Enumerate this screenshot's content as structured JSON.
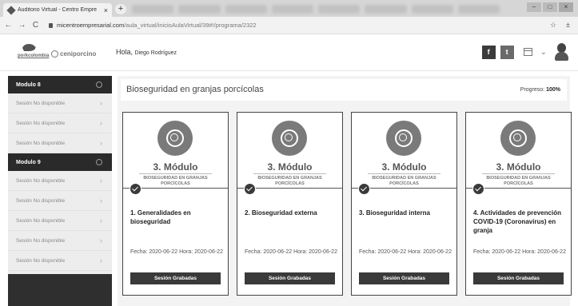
{
  "browser": {
    "tab_title": "Auditorio Virtual - Centro Empre",
    "tab_close": "×",
    "new_tab": "+",
    "url_host": "micentroempresarial.com",
    "url_path": "/aula_virtual/inicioAulaVirtual/39#!/programa/2322",
    "window_controls": [
      "–",
      "□",
      "×"
    ]
  },
  "header": {
    "logo_left": "porkcolombia",
    "logo_right": "ceniporcino",
    "greeting": "Hola,",
    "user_name": "Diego Rodríguez",
    "facebook": "f",
    "twitter": "t"
  },
  "sidebar": {
    "items": [
      {
        "type": "module",
        "label": "Modulo 8"
      },
      {
        "type": "session",
        "label": "Sesión No disponible"
      },
      {
        "type": "session",
        "label": "Sesión No disponible"
      },
      {
        "type": "session",
        "label": "Sesión No disponible"
      },
      {
        "type": "module",
        "label": "Modulo 9"
      },
      {
        "type": "session",
        "label": "Sesión No disponible"
      },
      {
        "type": "session",
        "label": "Sesión No disponible"
      },
      {
        "type": "session",
        "label": "Sesión No disponible"
      },
      {
        "type": "session",
        "label": "Sesión No disponible"
      },
      {
        "type": "session",
        "label": "Sesión No disponible"
      }
    ]
  },
  "main": {
    "title": "Bioseguridad en granjas porcícolas",
    "progress_label": "Progreso:",
    "progress_value": "100%",
    "cards": [
      {
        "module": "3. Módulo",
        "subtitle": "BIOSEGURIDAD EN GRANJAS PORCÍCOLAS",
        "title": "1. Generalidades en bioseguridad",
        "date": "Fecha: 2020-06-22 Hora: 2020-06-22",
        "button": "Sesión Grabadas"
      },
      {
        "module": "3. Módulo",
        "subtitle": "BIOSEGURIDAD EN GRANJAS PORCÍCOLAS",
        "title": "2. Bioseguridad externa",
        "date": "Fecha: 2020-06-22 Hora: 2020-06-22",
        "button": "Sesión Grabadas"
      },
      {
        "module": "3. Módulo",
        "subtitle": "BIOSEGURIDAD EN GRANJAS PORCÍCOLAS",
        "title": "3. Bioseguridad interna",
        "date": "Fecha: 2020-06-22 Hora: 2020-06-22",
        "button": "Sesión Grabadas"
      },
      {
        "module": "3. Módulo",
        "subtitle": "BIOSEGURIDAD EN GRANJAS PORCÍCOLAS",
        "title": "4. Actividades de prevención COVID-19 (Coronavirus) en granja",
        "date": "Fecha: 2020-06-22 Hora: 2020-06-22",
        "button": "Sesión Grabadas"
      }
    ]
  }
}
